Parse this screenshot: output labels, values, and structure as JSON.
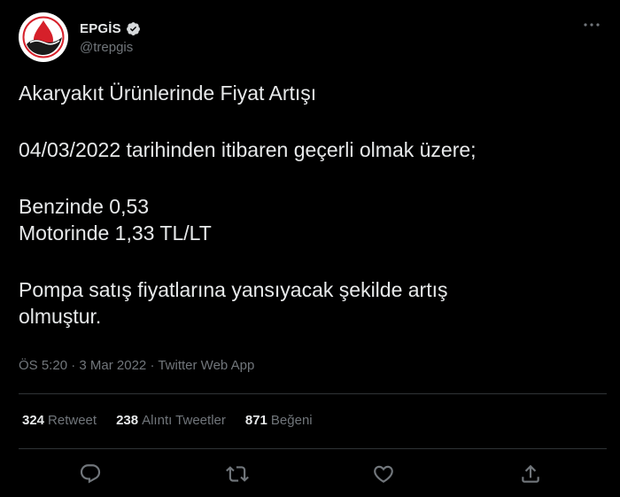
{
  "author": {
    "display_name": "EPGİS",
    "handle": "@trepgis",
    "verified": true,
    "avatar_icon": "epgis-logo-icon"
  },
  "tweet": {
    "line1": "Akaryakıt Ürünlerinde Fiyat Artışı",
    "line2": "04/03/2022 tarihinden itibaren geçerli olmak üzere;",
    "line3": "Benzinde 0,53",
    "line4": "Motorinde 1,33 TL/LT",
    "line5": "Pompa satış fiyatlarına yansıyacak şekilde artış",
    "line6": "olmuştur."
  },
  "meta": {
    "time": "ÖS 5:20",
    "separator": " · ",
    "date": "3 Mar 2022",
    "app": "Twitter Web App"
  },
  "stats": {
    "retweets_count": "324",
    "retweets_label": "Retweet",
    "quotes_count": "238",
    "quotes_label": "Alıntı Tweetler",
    "likes_count": "871",
    "likes_label": "Beğeni"
  },
  "actions": {
    "reply_icon": "reply-icon",
    "retweet_icon": "retweet-icon",
    "like_icon": "heart-icon",
    "share_icon": "share-icon"
  },
  "colors": {
    "background": "#000000",
    "text": "#e7e9ea",
    "muted": "#71767b",
    "divider": "#2f3336",
    "logo_red": "#d6202a"
  }
}
